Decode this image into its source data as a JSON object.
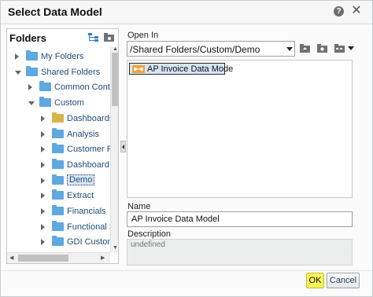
{
  "dialog": {
    "title": "Select Data Model"
  },
  "folders_panel": {
    "title": "Folders",
    "tree": [
      {
        "label": "My Folders",
        "level": 0,
        "state": "closed",
        "icon": "folder-icon"
      },
      {
        "label": "Shared Folders",
        "level": 0,
        "state": "open",
        "icon": "folder-icon"
      },
      {
        "label": "Common Conten",
        "level": 1,
        "state": "closed",
        "icon": "folder-icon"
      },
      {
        "label": "Custom",
        "level": 1,
        "state": "open",
        "icon": "folder-icon"
      },
      {
        "label": "Dashboards",
        "level": 2,
        "state": "closed",
        "icon": "dashboard-folder-icon"
      },
      {
        "label": "Analysis",
        "level": 2,
        "state": "closed",
        "icon": "folder-icon"
      },
      {
        "label": "Customer Re",
        "level": 2,
        "state": "closed",
        "icon": "folder-icon"
      },
      {
        "label": "Dashboard",
        "level": 2,
        "state": "closed",
        "icon": "folder-icon"
      },
      {
        "label": "Demo",
        "level": 2,
        "state": "closed",
        "icon": "folder-icon",
        "selected": true
      },
      {
        "label": "Extract",
        "level": 2,
        "state": "closed",
        "icon": "folder-icon"
      },
      {
        "label": "Financials",
        "level": 2,
        "state": "closed",
        "icon": "folder-icon"
      },
      {
        "label": "Functional Se",
        "level": 2,
        "state": "closed",
        "icon": "folder-icon"
      },
      {
        "label": "GDI Custom",
        "level": 2,
        "state": "closed",
        "icon": "folder-icon"
      }
    ]
  },
  "open_in": {
    "label": "Open In",
    "path": "/Shared Folders/Custom/Demo"
  },
  "files": [
    {
      "label": "AP Invoice Data Mode",
      "icon": "data-model-icon"
    }
  ],
  "name": {
    "label": "Name",
    "value": "AP Invoice Data Model"
  },
  "description": {
    "label": "Description",
    "value": "undefined"
  },
  "buttons": {
    "ok": "OK",
    "cancel": "Cancel"
  },
  "colors": {
    "selection": "#d7e6f5",
    "ok_highlight": "#f6f25a",
    "folder": "#5fa8e0"
  }
}
